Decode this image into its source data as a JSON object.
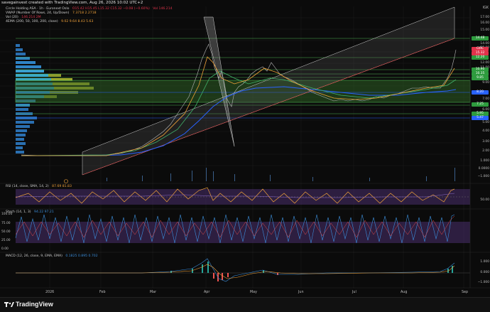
{
  "header": {
    "created_line": "savegainvest created with TradingView.com, Aug 26, 2026 10:02 UTC+2",
    "corner_label": "IGK"
  },
  "main_legend": {
    "symbol_line": "Circle Holding ASA · 1h · Euronext Oslo",
    "ohlc": "O15.42  H15.45  L15.32  C15.32  −0.08 (−0.60%)",
    "ohlc_extra": "Vol 146.214",
    "vwap_line": "VWAP (Number Of Rows, 24, Up/Down)",
    "vwap_values": "7.3718  2.2718",
    "vol_line": "Vol (20)",
    "vol_values": "146.214  2M",
    "ema_line": "4EMA (200, 50, 100, 200, close)",
    "ema_values": "9.02  9.64  8.43  5.63"
  },
  "price_axis": [
    "17.00",
    "16.00",
    "15.00",
    "14.00",
    "13.00",
    "12.00",
    "11.00",
    "10.00",
    "9.00",
    "8.00",
    "7.00",
    "6.00",
    "5.00",
    "4.00",
    "3.00",
    "2.00",
    "1.000",
    "0.0000",
    "−1.000"
  ],
  "price_tags": [
    {
      "text": "14.48",
      "color": "#2e9b3e"
    },
    {
      "text": "CIRC",
      "color": "#e0334b"
    },
    {
      "text": "15.32",
      "color": "#e0334b"
    },
    {
      "text": "12.20",
      "color": "#2e9b3e"
    },
    {
      "text": "10.90",
      "color": "#2e9b3e"
    },
    {
      "text": "10.35",
      "color": "#2e9b3e"
    },
    {
      "text": "9.85",
      "color": "#2e9b3e"
    },
    {
      "text": "8.20",
      "color": "#2962ff"
    },
    {
      "text": "7.25",
      "color": "#2e9b3e"
    },
    {
      "text": "5.95",
      "color": "#2e9b3e"
    },
    {
      "text": "5.47",
      "color": "#2962ff"
    }
  ],
  "rsi": {
    "label": "RSI (14, close, SMA, 14, 2)",
    "values": "87.69  81.83",
    "axis": [
      "50.00"
    ]
  },
  "stoch": {
    "label": "Stoch (14, 1, 3)",
    "values": "94.22  97.21",
    "axis": [
      "100.00",
      "75.00",
      "50.00",
      "25.00",
      "0.00"
    ]
  },
  "macd": {
    "label": "MACD (12, 26, close, 9, EMA, EMA)",
    "values": "0.1825  0.895  0.702",
    "axis": [
      "1.000",
      "0.000",
      "−1.000"
    ]
  },
  "time_axis": [
    "2026",
    "Feb",
    "Mar",
    "Apr",
    "May",
    "Jun",
    "Jul",
    "Aug",
    "Sep"
  ],
  "colors": {
    "ema_fast": "#f0a23a",
    "ema_mid": "#41b36b",
    "ema_slow": "#2962ff",
    "price": "#b9b9b9",
    "channel": "#cfcfcf",
    "zone_green": "#4caf50",
    "rsi": "#f0a23a",
    "stoch_k": "#3c8dd9",
    "stoch_d": "#e04b4b"
  },
  "footer": {
    "brand": "TradingView"
  }
}
